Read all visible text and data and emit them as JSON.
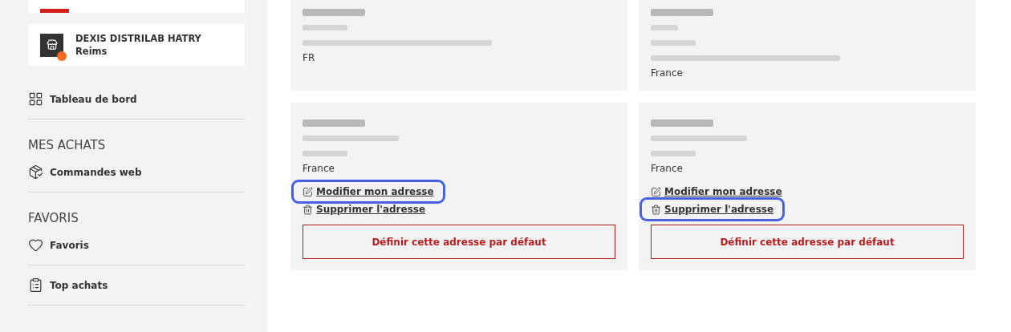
{
  "sidebar": {
    "store": {
      "name": "DEXIS DISTRILAB HATRY",
      "city": "Reims"
    },
    "sections": [
      {
        "items": [
          {
            "label": "Tableau de bord",
            "kind": "dashboard"
          }
        ]
      },
      {
        "heading": "MES ACHATS",
        "items": [
          {
            "label": "Commandes web",
            "kind": "package"
          }
        ]
      },
      {
        "heading": "FAVORIS",
        "items": [
          {
            "label": "Favoris",
            "kind": "heart"
          },
          {
            "label": "Top achats",
            "kind": "clipboard"
          }
        ]
      }
    ]
  },
  "addresses": [
    {
      "redacted_lines": [
        {
          "kind": "name"
        },
        {
          "kind": "short"
        },
        {
          "kind": "long"
        }
      ],
      "country": "FR"
    },
    {
      "redacted_lines": [
        {
          "kind": "name"
        },
        {
          "kind": "tiny"
        },
        {
          "kind": "short"
        },
        {
          "kind": "long"
        }
      ],
      "country": "France"
    },
    {
      "redacted_lines": [
        {
          "kind": "name"
        },
        {
          "kind": "medium"
        },
        {
          "kind": "short"
        }
      ],
      "country": "France",
      "actions": [
        {
          "kind": "edit",
          "label": "Modifier mon adresse",
          "highlighted": true
        },
        {
          "kind": "delete",
          "label": "Supprimer l'adresse",
          "highlighted": false
        }
      ],
      "default_button": "Définir cette adresse par défaut"
    },
    {
      "redacted_lines": [
        {
          "kind": "name"
        },
        {
          "kind": "medium"
        },
        {
          "kind": "short"
        }
      ],
      "country": "France",
      "actions": [
        {
          "kind": "edit",
          "label": "Modifier mon adresse",
          "highlighted": false
        },
        {
          "kind": "delete",
          "label": "Supprimer l'adresse",
          "highlighted": true
        }
      ],
      "default_button": "Définir cette adresse par défaut"
    }
  ]
}
